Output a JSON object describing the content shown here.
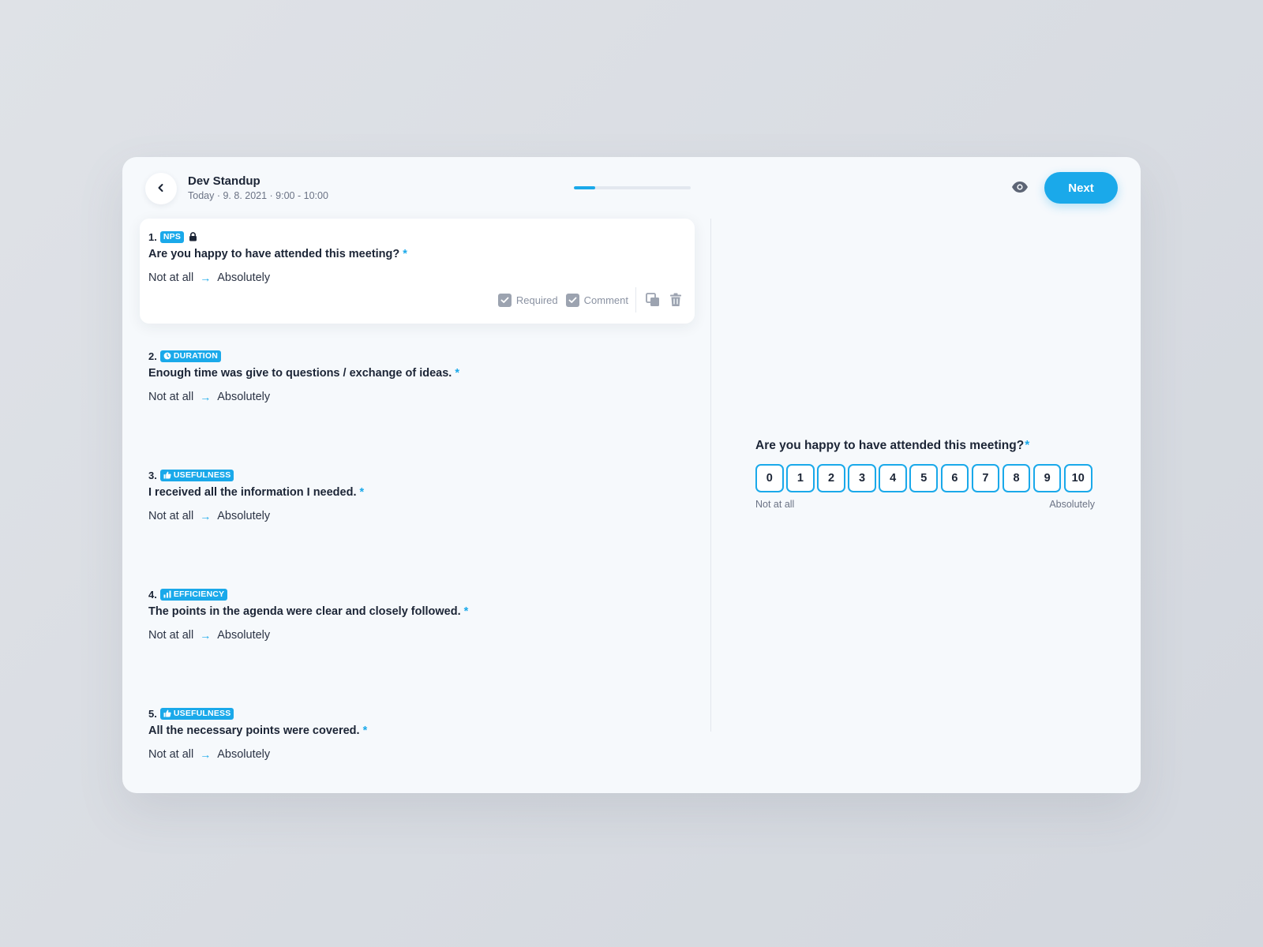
{
  "header": {
    "title": "Dev Standup",
    "subtitle": "Today · 9. 8. 2021 · 9:00 - 10:00",
    "next_label": "Next",
    "progress": 0.18
  },
  "questions": [
    {
      "num": "1.",
      "tag": "NPS",
      "tag_icon": "none",
      "locked": true,
      "text": "Are you happy to have attended this meeting?",
      "star": "*",
      "low": "Not at all",
      "high": "Absolutely"
    },
    {
      "num": "2.",
      "tag": "DURATION",
      "tag_icon": "clock-icon",
      "text": "Enough time was give to questions / exchange of ideas.",
      "star": "*",
      "low": "Not at all",
      "high": "Absolutely"
    },
    {
      "num": "3.",
      "tag": "USEFULNESS",
      "tag_icon": "thumbs-up-icon",
      "text": "I received all the information I needed.",
      "star": "*",
      "low": "Not at all",
      "high": "Absolutely"
    },
    {
      "num": "4.",
      "tag": "EFFICIENCY",
      "tag_icon": "bar-chart-icon",
      "text": "The points in the agenda were clear and closely followed.",
      "star": "*",
      "low": "Not at all",
      "high": "Absolutely"
    },
    {
      "num": "5.",
      "tag": "USEFULNESS",
      "tag_icon": "thumbs-up-icon",
      "text": "All the necessary points were covered.",
      "star": "*",
      "low": "Not at all",
      "high": "Absolutely"
    }
  ],
  "tools": {
    "required_label": "Required",
    "comment_label": "Comment"
  },
  "preview": {
    "question": "Are you happy to have attended this meeting?",
    "star": "*",
    "scale": [
      "0",
      "1",
      "2",
      "3",
      "4",
      "5",
      "6",
      "7",
      "8",
      "9",
      "10"
    ],
    "low_label": "Not at all",
    "high_label": "Absolutely"
  },
  "colors": {
    "accent": "#1aa9ea",
    "text": "#1c2536",
    "muted": "#6b7385"
  }
}
